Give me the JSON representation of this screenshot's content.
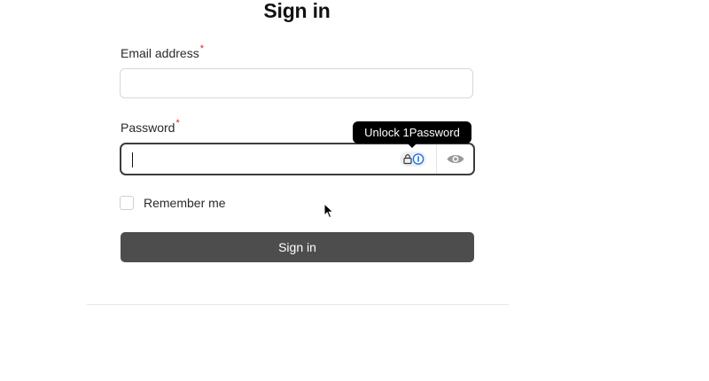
{
  "page": {
    "title": "Sign in"
  },
  "form": {
    "email": {
      "label": "Email address",
      "required_mark": "*",
      "value": "",
      "placeholder": ""
    },
    "password": {
      "label": "Password",
      "required_mark": "*",
      "value": "",
      "placeholder": "",
      "autofill_icon": "1password-lock-icon",
      "toggle_icon": "eye-icon"
    },
    "remember": {
      "label": "Remember me",
      "checked": false
    },
    "submit_label": "Sign in"
  },
  "tooltip": {
    "text": "Unlock 1Password"
  },
  "colors": {
    "button_bg": "#4d4d4d",
    "required": "#d62828",
    "onepassword_blue": "#1a73e8",
    "focus_border": "#3c3c3c"
  }
}
